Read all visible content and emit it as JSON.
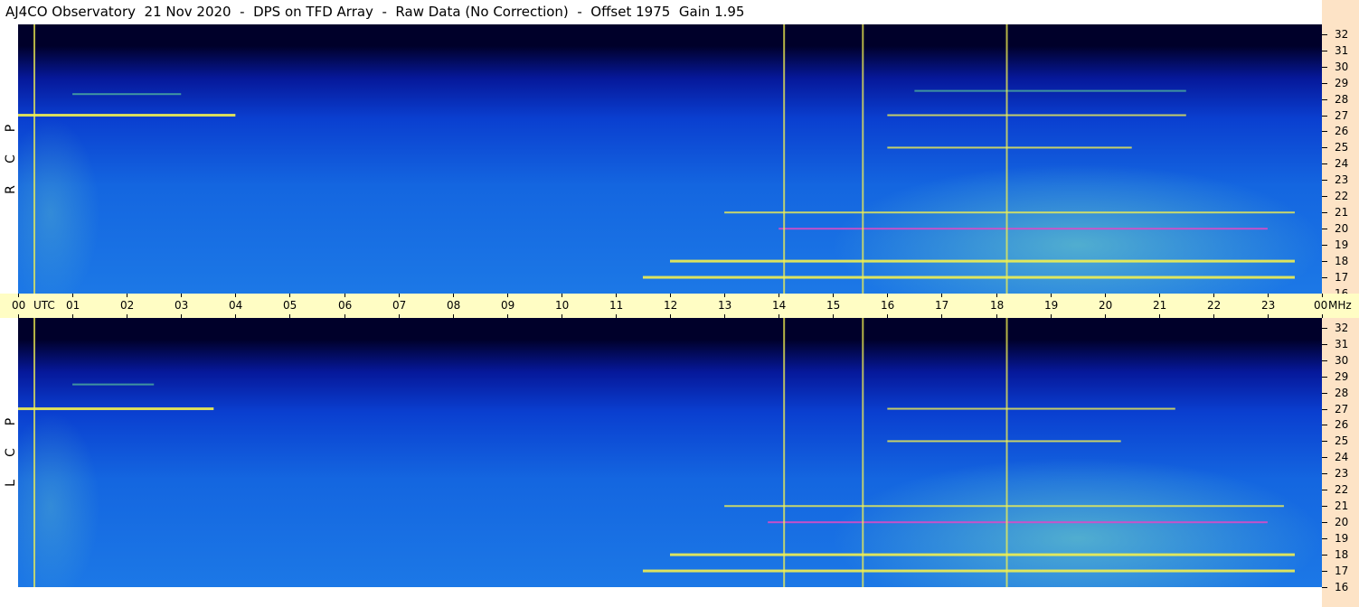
{
  "header": {
    "title": "AJ4CO Observatory  21 Nov 2020  -  DPS on TFD Array  -  Raw Data (No Correction)  -  Offset 1975  Gain 1.95"
  },
  "panels": [
    {
      "id": "rcp",
      "letters": [
        "P",
        "C",
        "R"
      ]
    },
    {
      "id": "lcp",
      "letters": [
        "P",
        "C",
        "L"
      ]
    }
  ],
  "time_axis": {
    "start_label": "00",
    "unit_label": "UTC",
    "hours": [
      "01",
      "02",
      "03",
      "04",
      "05",
      "06",
      "07",
      "08",
      "09",
      "10",
      "11",
      "12",
      "13",
      "14",
      "15",
      "16",
      "17",
      "18",
      "19",
      "20",
      "21",
      "22",
      "23"
    ],
    "end_label": "00",
    "freq_unit": "MHz"
  },
  "colors": {
    "background_sky": "#1c78e6",
    "top_dark": "#00002a",
    "burst_yellow": "#f2f050",
    "burst_green": "#66e09a",
    "burst_magenta": "#d64cc8",
    "timebar_bg": "#fffdc4",
    "freqbar_bg": "#fde3c6"
  },
  "chart_data": [
    {
      "type": "heatmap",
      "title": "",
      "panel": "RCP",
      "x_range": [
        "00 UTC",
        "00 UTC"
      ],
      "y_range_mhz": [
        16,
        32
      ],
      "y_ticks": [
        32,
        31,
        30,
        29,
        28,
        27,
        26,
        25,
        24,
        23,
        22,
        21,
        20,
        19,
        18,
        17,
        16
      ],
      "features": [
        {
          "kind": "emission_band",
          "freq_mhz": 27,
          "start_utc": 0.0,
          "end_utc": 4.0,
          "strength": "strong"
        },
        {
          "kind": "emission_band",
          "freq_mhz": 28.3,
          "start_utc": 1.0,
          "end_utc": 3.0,
          "strength": "weak"
        },
        {
          "kind": "emission_band",
          "freq_mhz": 27,
          "start_utc": 16.0,
          "end_utc": 21.5,
          "strength": "medium"
        },
        {
          "kind": "emission_band",
          "freq_mhz": 28.5,
          "start_utc": 16.5,
          "end_utc": 21.5,
          "strength": "weak"
        },
        {
          "kind": "emission_band",
          "freq_mhz": 25,
          "start_utc": 16.0,
          "end_utc": 20.5,
          "strength": "medium"
        },
        {
          "kind": "emission_band",
          "freq_mhz": 21,
          "start_utc": 13.0,
          "end_utc": 23.5,
          "strength": "medium"
        },
        {
          "kind": "emission_band",
          "freq_mhz": 20,
          "start_utc": 14.0,
          "end_utc": 23.0,
          "strength": "magenta"
        },
        {
          "kind": "emission_band",
          "freq_mhz": 18,
          "start_utc": 12.0,
          "end_utc": 23.5,
          "strength": "strong"
        },
        {
          "kind": "emission_band",
          "freq_mhz": 17,
          "start_utc": 11.5,
          "end_utc": 23.5,
          "strength": "strong"
        },
        {
          "kind": "vertical_interference",
          "utc": 0.3
        },
        {
          "kind": "vertical_interference",
          "utc": 14.1
        },
        {
          "kind": "vertical_interference",
          "utc": 15.55
        },
        {
          "kind": "vertical_interference",
          "utc": 18.2
        }
      ]
    },
    {
      "type": "heatmap",
      "title": "",
      "panel": "LCP",
      "x_range": [
        "00 UTC",
        "00 UTC"
      ],
      "y_range_mhz": [
        16,
        32
      ],
      "y_ticks": [
        32,
        31,
        30,
        29,
        28,
        27,
        26,
        25,
        24,
        23,
        22,
        21,
        20,
        19,
        18,
        17,
        16
      ],
      "features": [
        {
          "kind": "emission_band",
          "freq_mhz": 27,
          "start_utc": 0.0,
          "end_utc": 3.6,
          "strength": "strong"
        },
        {
          "kind": "emission_band",
          "freq_mhz": 28.5,
          "start_utc": 1.0,
          "end_utc": 2.5,
          "strength": "weak"
        },
        {
          "kind": "emission_band",
          "freq_mhz": 27,
          "start_utc": 16.0,
          "end_utc": 21.3,
          "strength": "medium"
        },
        {
          "kind": "emission_band",
          "freq_mhz": 25,
          "start_utc": 16.0,
          "end_utc": 20.3,
          "strength": "medium"
        },
        {
          "kind": "emission_band",
          "freq_mhz": 21,
          "start_utc": 13.0,
          "end_utc": 23.3,
          "strength": "medium"
        },
        {
          "kind": "emission_band",
          "freq_mhz": 20,
          "start_utc": 13.8,
          "end_utc": 23.0,
          "strength": "magenta"
        },
        {
          "kind": "emission_band",
          "freq_mhz": 18,
          "start_utc": 12.0,
          "end_utc": 23.5,
          "strength": "strong"
        },
        {
          "kind": "emission_band",
          "freq_mhz": 17,
          "start_utc": 11.5,
          "end_utc": 23.5,
          "strength": "strong"
        },
        {
          "kind": "vertical_interference",
          "utc": 0.3
        },
        {
          "kind": "vertical_interference",
          "utc": 14.1
        },
        {
          "kind": "vertical_interference",
          "utc": 15.55
        },
        {
          "kind": "vertical_interference",
          "utc": 18.2
        }
      ]
    }
  ]
}
